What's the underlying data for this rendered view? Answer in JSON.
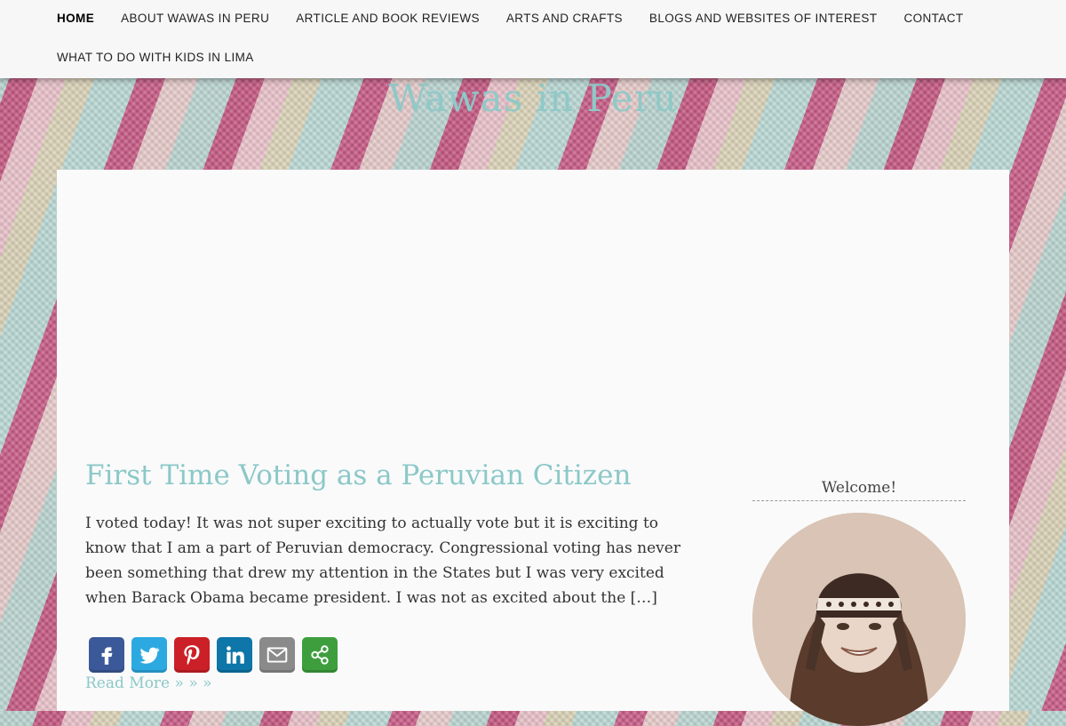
{
  "nav": {
    "row1": [
      "Home",
      "About Wawas in Peru",
      "Article and Book Reviews",
      "Arts and Crafts",
      "Blogs and Websites of Interest",
      "Contact"
    ],
    "row2": [
      "What to do with kids in Lima"
    ]
  },
  "site": {
    "title": "Wawas in Peru"
  },
  "post": {
    "title": "First Time Voting as a Peruvian Citizen",
    "excerpt": "I voted today! It was not super exciting to actually vote but it is exciting to know that I am a part of Peruvian democracy. Congressional voting has never been something that drew my attention in the States but I was very excited when Barack Obama became president. I was not as excited about the […]",
    "read_more": "Read More » » »"
  },
  "share": [
    {
      "name": "facebook-icon",
      "color": "#3b5998"
    },
    {
      "name": "twitter-icon",
      "color": "#2da9e1"
    },
    {
      "name": "pinterest-icon",
      "color": "#cb2027"
    },
    {
      "name": "linkedin-icon",
      "color": "#0e76a8"
    },
    {
      "name": "email-icon",
      "color": "#8a8a8a"
    },
    {
      "name": "more-icon",
      "color": "#3e9e3e"
    }
  ],
  "sidebar": {
    "widget_title": "Welcome!"
  },
  "colors": {
    "accent": "#8cc8c8",
    "nav_bg": "#f7f7f7",
    "content_bg": "#fafafa"
  }
}
